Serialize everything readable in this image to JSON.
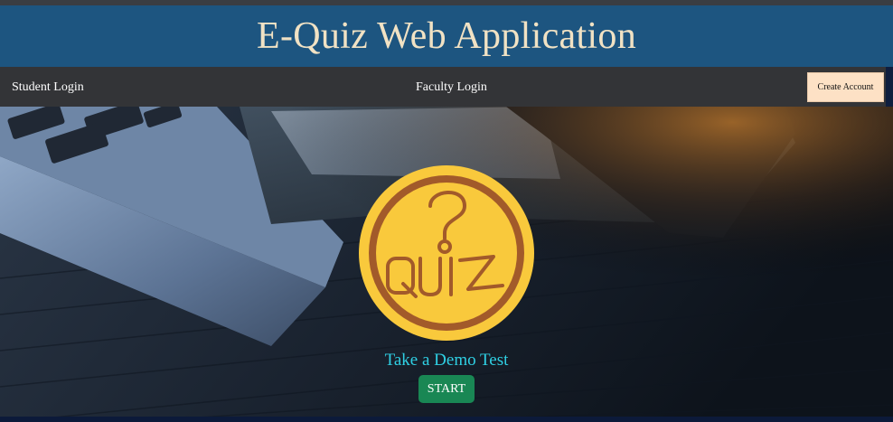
{
  "app": {
    "title": "E-Quiz Web Application"
  },
  "nav": {
    "student_login": "Student Login",
    "faculty_login": "Faculty Login",
    "create_account": "Create Account"
  },
  "hero": {
    "background": "laptop-and-tablet-on-dark-wood-photo",
    "logo_icon": "quiz-badge-icon",
    "logo_text": "QUIZ",
    "logo_symbol": "?",
    "demo_text": "Take a Demo Test",
    "start_label": "START"
  },
  "colors": {
    "header_bg": "#1d5580",
    "title_text": "#f1e2c4",
    "nav_bg": "#333437",
    "create_btn_bg": "#fde1c5",
    "demo_text": "#2fd0e4",
    "start_btn_bg": "#198754",
    "logo_gold": "#f9c93c",
    "logo_brown": "#a25a2a"
  }
}
